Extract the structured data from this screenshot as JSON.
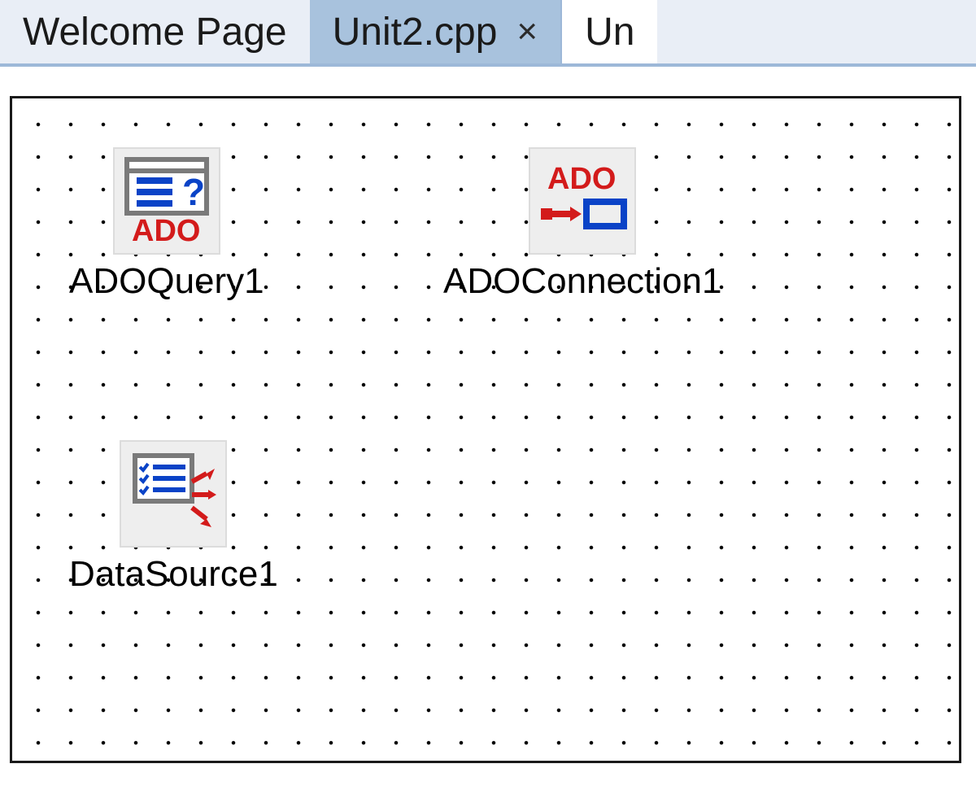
{
  "tabs": {
    "welcome": {
      "label": "Welcome Page"
    },
    "active": {
      "label": "Unit2.cpp",
      "close_glyph": "×"
    },
    "cutoff": {
      "label": "Un"
    }
  },
  "components": {
    "adoquery": {
      "label": "ADOQuery1",
      "icon": "ado-query-icon"
    },
    "adoconn": {
      "label": "ADOConnection1",
      "icon": "ado-connection-icon"
    },
    "datasource": {
      "label": "DataSource1",
      "icon": "data-source-icon"
    }
  },
  "colors": {
    "tab_bg": "#e9eef6",
    "tab_active_bg": "#a8c2dd",
    "tab_border": "#9db8d8",
    "icon_blue": "#0a43c7",
    "icon_red": "#d31b1b",
    "icon_gray": "#7a7a7a"
  }
}
